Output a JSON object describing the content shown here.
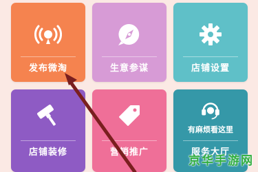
{
  "tiles": [
    {
      "label": "发布微淘",
      "icon": "broadcast-icon",
      "color": "#f5834f"
    },
    {
      "label": "生意参谋",
      "icon": "compass-icon",
      "color": "#d79bd6"
    },
    {
      "label": "店铺设置",
      "icon": "gear-icon",
      "color": "#5fc0c8"
    },
    {
      "label": "店铺装修",
      "icon": "brush-icon",
      "color": "#8e5bc4"
    },
    {
      "label": "营销推广",
      "icon": "tag-icon",
      "color": "#ef6f98"
    },
    {
      "label": "服务大厅",
      "icon": "headset-icon",
      "color": "#3598a8",
      "sub_text": "有麻烦看这里"
    }
  ],
  "watermark": "京华手游网"
}
